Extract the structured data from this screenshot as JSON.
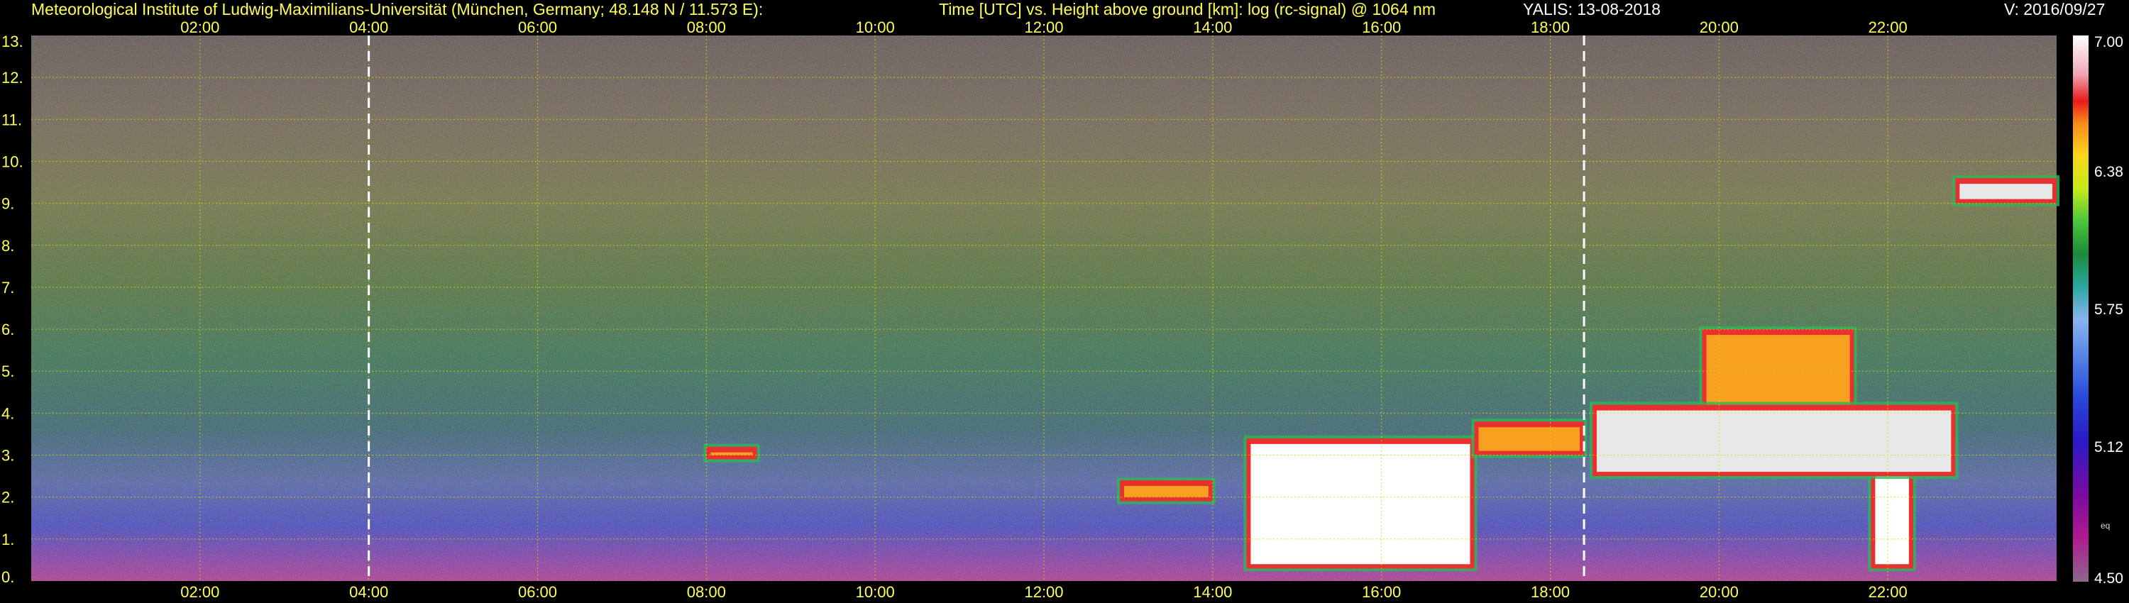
{
  "header": {
    "institute": "Meteorological Institute of Ludwig-Maximilians-Universität (München, Germany; 48.148 N / 11.573 E):",
    "description": "Time [UTC] vs. Height above ground [km]: log (rc-signal) @ 1064 nm",
    "instrument_date": "YALIS: 13-08-2018",
    "version": "V: 2016/09/27"
  },
  "colorbar": {
    "tick_labels": [
      "7.00",
      "6.38",
      "5.75",
      "5.12",
      "4.50"
    ],
    "tick_values": [
      7.0,
      6.38,
      5.75,
      5.12,
      4.5
    ],
    "small_label": "eq"
  },
  "chart_data": {
    "type": "heatmap",
    "title": "Time [UTC] vs. Height above ground [km]: log (rc-signal) @ 1064 nm",
    "xlabel": "Time [UTC]",
    "ylabel": "Height above ground [km]",
    "x_tick_labels": [
      "02:00",
      "04:00",
      "06:00",
      "08:00",
      "10:00",
      "12:00",
      "14:00",
      "16:00",
      "18:00",
      "20:00",
      "22:00"
    ],
    "x_tick_hours": [
      2,
      4,
      6,
      8,
      10,
      12,
      14,
      16,
      18,
      20,
      22
    ],
    "xlim_hours": [
      0.0,
      24.0
    ],
    "y_tick_labels": [
      "0.",
      "1.",
      "2.",
      "3.",
      "4.",
      "5.",
      "6.",
      "7.",
      "8.",
      "9.",
      "10.",
      "11.",
      "12.",
      "13."
    ],
    "y_ticks_km": [
      0,
      1,
      2,
      3,
      4,
      5,
      6,
      7,
      8,
      9,
      10,
      11,
      12,
      13
    ],
    "ylim_km": [
      0,
      13
    ],
    "grid": true,
    "value_range": [
      4.5,
      7.0
    ],
    "gap_markers_hours": [
      4.0,
      18.4
    ],
    "cloud_features": [
      {
        "t_start": 14.4,
        "t_end": 17.1,
        "base_km": 0.3,
        "top_km": 3.4,
        "log_signal": 7.0
      },
      {
        "t_start": 21.8,
        "t_end": 22.3,
        "base_km": 0.3,
        "top_km": 3.0,
        "log_signal": 7.0
      },
      {
        "t_start": 19.8,
        "t_end": 21.6,
        "base_km": 4.0,
        "top_km": 6.0,
        "log_signal": 6.6
      },
      {
        "t_start": 17.1,
        "t_end": 18.4,
        "base_km": 3.0,
        "top_km": 3.8,
        "log_signal": 6.5
      },
      {
        "t_start": 8.0,
        "t_end": 8.6,
        "base_km": 2.9,
        "top_km": 3.2,
        "log_signal": 6.4
      },
      {
        "t_start": 12.9,
        "t_end": 14.0,
        "base_km": 1.9,
        "top_km": 2.4,
        "log_signal": 6.4
      },
      {
        "t_start": 18.5,
        "t_end": 22.8,
        "base_km": 2.5,
        "top_km": 4.2,
        "log_signal": 6.2
      },
      {
        "t_start": 22.8,
        "t_end": 24.0,
        "base_km": 9.0,
        "top_km": 9.6,
        "log_signal": 6.2
      }
    ]
  }
}
